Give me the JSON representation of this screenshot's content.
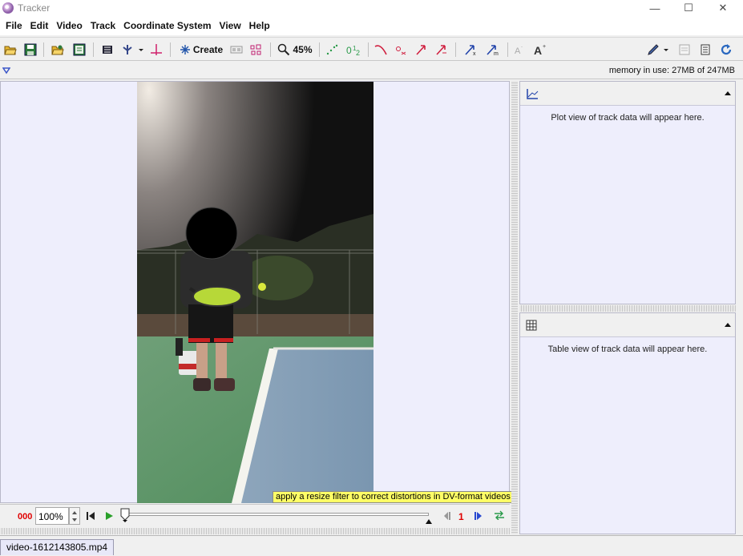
{
  "window": {
    "title": "Tracker",
    "minimize_icon": "minimize-icon",
    "maximize_icon": "maximize-icon",
    "close_icon": "close-icon"
  },
  "menu": [
    "File",
    "Edit",
    "Video",
    "Track",
    "Coordinate System",
    "View",
    "Help"
  ],
  "toolbar": {
    "create_label": "Create",
    "zoom_label": "45%"
  },
  "memory": {
    "text": "memory in use: 27MB of 247MB"
  },
  "video": {
    "warning": "apply a resize filter to correct distortions in DV-format videos"
  },
  "player": {
    "frame_number": "000",
    "rate": "100%",
    "step_size": "1"
  },
  "plot_panel": {
    "message": "Plot view of track data will appear here."
  },
  "table_panel": {
    "message": "Table view of track data will appear here."
  },
  "tabs": {
    "file_tab": "video-1612143805.mp4"
  }
}
